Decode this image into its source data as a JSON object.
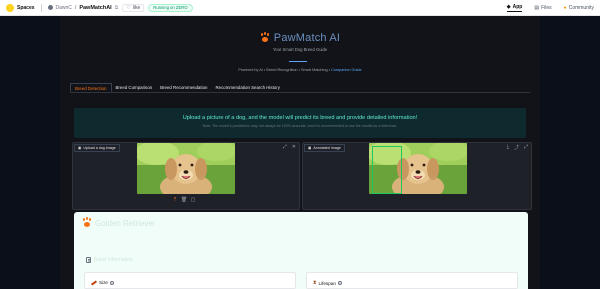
{
  "hf_bar": {
    "brand": "Spaces",
    "owner": "DawnC",
    "space_name": "PawMatchAI",
    "like_label": "like",
    "status": "Running on ZERO",
    "tabs": [
      {
        "label": "App",
        "icon": "app-icon",
        "active": true
      },
      {
        "label": "Files",
        "icon": "files-icon",
        "active": false
      },
      {
        "label": "Community",
        "icon": "community-icon",
        "active": false
      }
    ]
  },
  "header": {
    "title": "PawMatch AI",
    "subtitle": "Your Smart Dog Breed Guide",
    "powered_prefix": "Powered by AI • Breed Recognition • Smart Matching • ",
    "powered_highlight": "Companion Guide"
  },
  "tabs": [
    {
      "label": "Breed Detection",
      "active": true
    },
    {
      "label": "Breed Comparison",
      "active": false
    },
    {
      "label": "Breed Recommendation",
      "active": false
    },
    {
      "label": "Recommendation Search History",
      "active": false
    }
  ],
  "banner": {
    "main": "Upload a picture of a dog, and the model will predict its breed and provide detailed information!",
    "note": "Note: The model's predictions may not always be 100% accurate, and it is recommended to use the results as a reference."
  },
  "upload_panel": {
    "label": "Upload a dog image"
  },
  "annotated_panel": {
    "label": "Annotated Image"
  },
  "results": {
    "title": "Golden Retriever",
    "section": "Basic Information",
    "cards": [
      {
        "label": "Size",
        "value": ""
      },
      {
        "label": "Lifespan",
        "value": ""
      }
    ]
  },
  "colors": {
    "accent": "#f97316",
    "title": "#6b8fbf",
    "banner_text": "#5eead4",
    "bbox": "#22c55e"
  }
}
